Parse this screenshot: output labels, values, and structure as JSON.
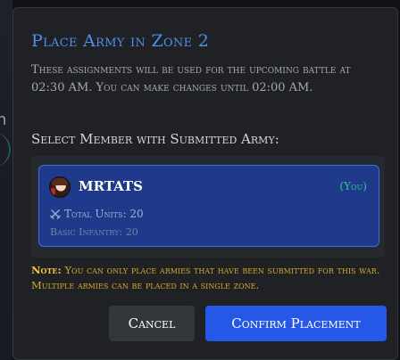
{
  "modal": {
    "title": "Place Army in Zone 2",
    "description": "These assignments will be used for the upcoming battle at 02:30 AM. You can make changes until 02:00 AM.",
    "select_label": "Select Member with Submitted Army:"
  },
  "members": [
    {
      "name": "MRTATS",
      "badge": "(You)",
      "total_units": "Total Units: 20",
      "basic_infantry": "Basic Infantry: 20",
      "avatar_icon": "user-avatar",
      "units_icon": "crossed-swords-icon",
      "selected": true
    }
  ],
  "note": {
    "prefix": "Note:",
    "text": "You can only place armies that have been submitted for this war. Multiple armies can be placed in a single zone."
  },
  "buttons": {
    "cancel": "Cancel",
    "confirm": "Confirm Placement"
  },
  "background": {
    "partial_text": "n"
  },
  "colors": {
    "accent": "#4f8fe6",
    "selected_card": "#1f3a8a",
    "confirm_button": "#2558e6",
    "you_badge": "#35c68a",
    "note": "#d8a928"
  }
}
